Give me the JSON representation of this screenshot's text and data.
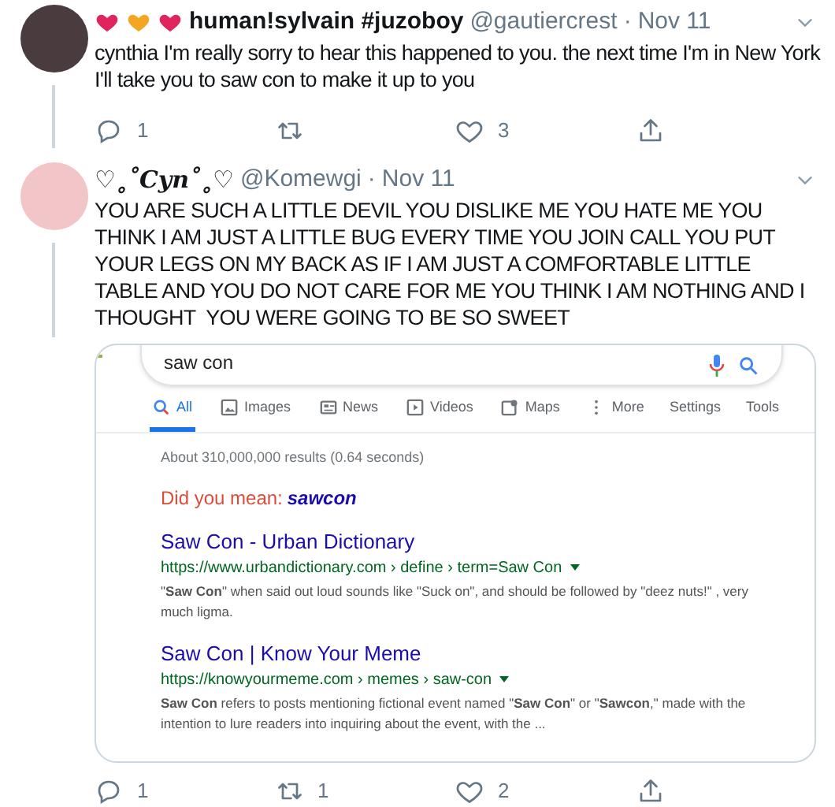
{
  "tweets": [
    {
      "display_name": "human!sylvain #juzoboy",
      "handle": "@gautiercrest",
      "separator": "·",
      "date": "Nov 11",
      "text": "cynthia I'm really sorry to hear this happened to you. the next time I'm in New York I'll take you to saw con to make it up to you",
      "replies": "1",
      "likes": "3",
      "thread_line_below": true
    },
    {
      "display_name": "♡˳˚Cyn˚˳♡",
      "handle": "@Komewgi",
      "separator": "·",
      "date": "Nov 11",
      "text": "YOU ARE SUCH A LITTLE DEVIL YOU DISLIKE ME YOU HATE ME YOU THINK I AM JUST A LITTLE BUG EVERY TIME YOU JOIN CALL YOU PUT YOUR LEGS ON MY BACK AS IF I AM JUST A COMFORTABLE LITTLE  TABLE AND YOU DO NOT CARE FOR ME YOU THINK I AM NOTHING AND I THOUGHT  YOU WERE GOING TO BE SO SWEET",
      "replies": "1",
      "retweets": "1",
      "likes": "2",
      "thread_line_below": true,
      "media": {
        "query": "saw con",
        "tabs": [
          {
            "label": "All",
            "selected": true
          },
          {
            "label": "Images",
            "selected": false
          },
          {
            "label": "News",
            "selected": false
          },
          {
            "label": "Videos",
            "selected": false
          },
          {
            "label": "Maps",
            "selected": false
          },
          {
            "label": "More",
            "selected": false
          }
        ],
        "tools": [
          "Settings",
          "Tools"
        ],
        "result_stats": "About 310,000,000 results (0.64 seconds)",
        "did_you_mean": {
          "prefix": "Did you mean:",
          "suggestion": "sawcon"
        },
        "results": [
          {
            "title": "Saw Con - Urban Dictionary",
            "url": "https://www.urbandictionary.com › define › term=Saw Con",
            "snippet": "\"**Saw Con**\" when said out loud sounds like \"Suck on\", and should be followed by \"deez nuts!\" , very much ligma."
          },
          {
            "title": "Saw Con | Know Your Meme",
            "url": "https://knowyourmeme.com › memes › saw-con",
            "snippet": "**Saw Con** refers to posts mentioning fictional event named \"**Saw Con**\" or \"**Sawcon**,\" made with the intention to lure readers into inquiring about the event, with the ..."
          }
        ]
      }
    }
  ]
}
